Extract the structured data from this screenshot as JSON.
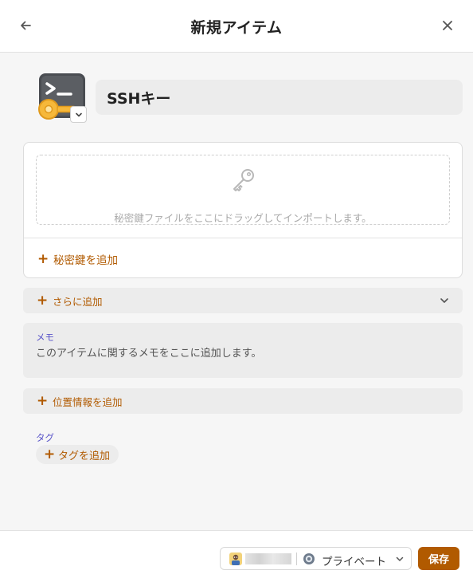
{
  "header": {
    "title": "新規アイテム"
  },
  "item": {
    "icon": "terminal-key-icon",
    "title": "SSHキー"
  },
  "private_key": {
    "dropzone_hint": "秘密鍵ファイルをここにドラッグしてインポートします。",
    "add_label": "秘密鍵を追加"
  },
  "more": {
    "label": "さらに追加"
  },
  "memo": {
    "label": "メモ",
    "placeholder": "このアイテムに関するメモをここに追加します。"
  },
  "location": {
    "label": "位置情報を追加"
  },
  "tags": {
    "label": "タグ",
    "add_label": "タグを追加"
  },
  "footer": {
    "vault_name": "プライベート",
    "save_label": "保存"
  },
  "colors": {
    "accent": "#b15a00",
    "field_label": "#5a55c9"
  }
}
